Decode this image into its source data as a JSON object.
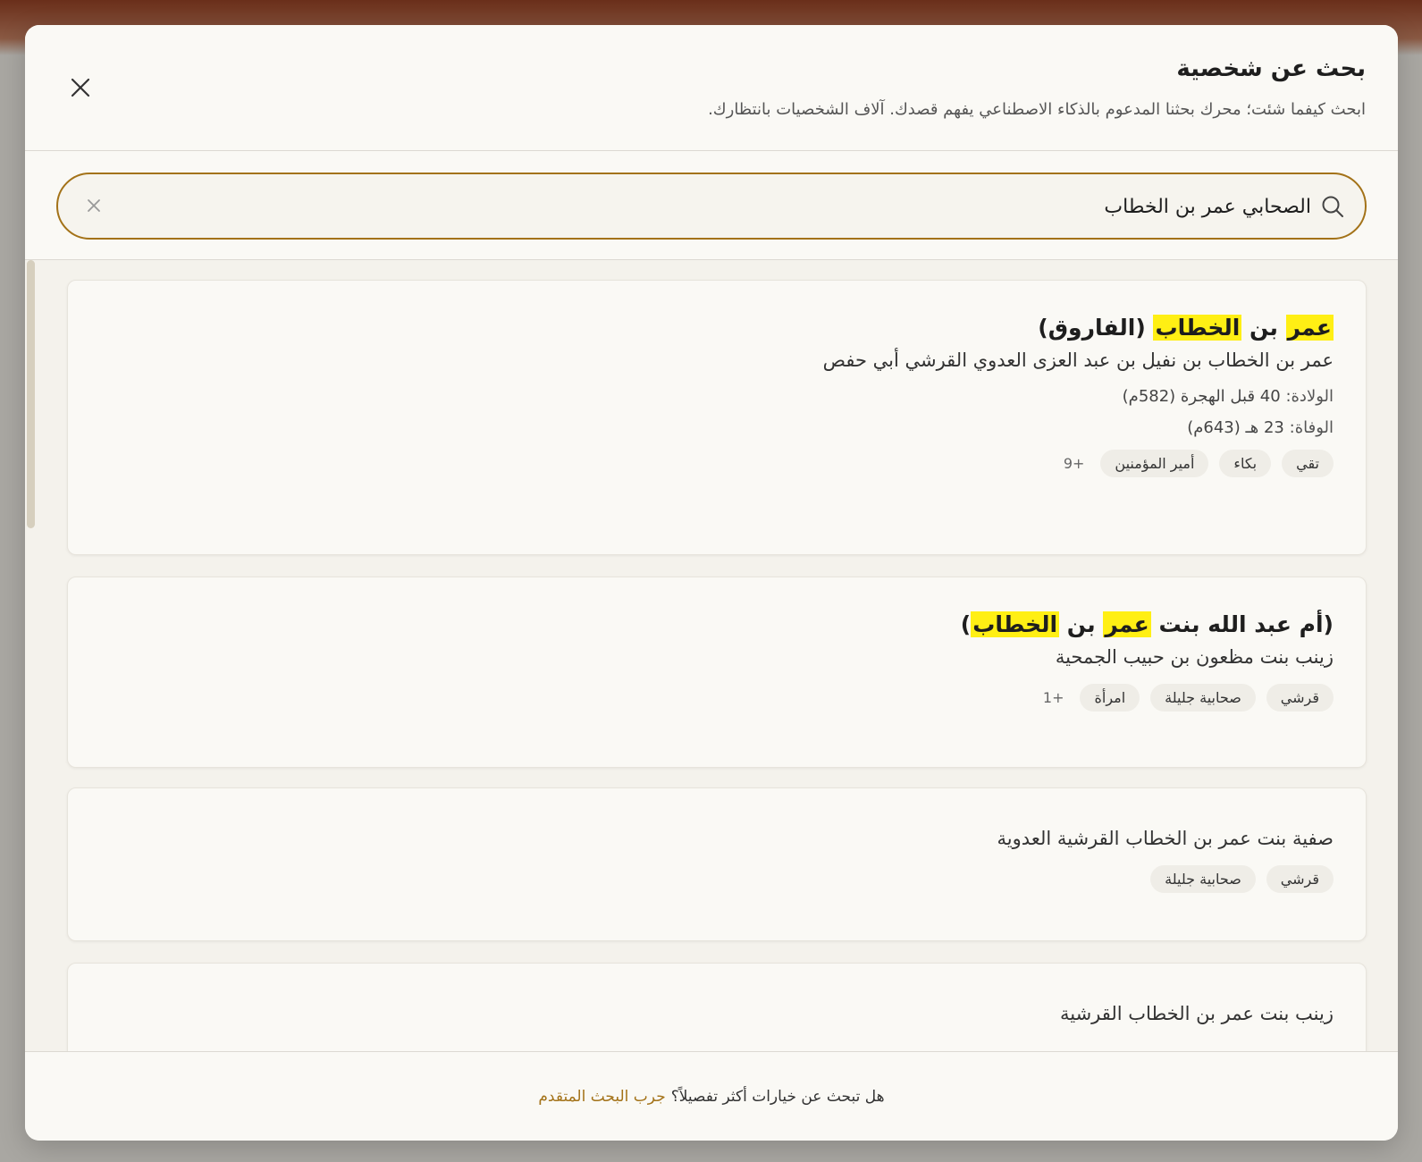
{
  "modal": {
    "title": "بحث عن شخصية",
    "subtitle": "ابحث كيفما شئت؛ محرك بحثنا المدعوم بالذكاء الاصطناعي يفهم قصدك. آلاف الشخصيات بانتظارك."
  },
  "search": {
    "value": "الصحابي عمر بن الخطاب"
  },
  "results": [
    {
      "title_parts": [
        {
          "text": "عمر",
          "hl": true
        },
        {
          "text": " بن ",
          "hl": false
        },
        {
          "text": "الخطاب",
          "hl": true
        },
        {
          "text": " (الفاروق)",
          "hl": false
        }
      ],
      "full_name": "عمر بن الخطاب بن نفيل بن عبد العزى العدوي القرشي أبي حفص",
      "birth_label": "الولادة:",
      "birth_value": "40 قبل الهجرة (582م)",
      "death_label": "الوفاة:",
      "death_value": "23 هـ (643م)",
      "tags": [
        "تقي",
        "بكاء",
        "أمير المؤمنين"
      ],
      "more": "+9"
    },
    {
      "title_parts": [
        {
          "text": "(أم عبد الله بنت ",
          "hl": false
        },
        {
          "text": "عمر",
          "hl": true
        },
        {
          "text": " بن ",
          "hl": false
        },
        {
          "text": "الخطاب",
          "hl": true
        },
        {
          "text": ")",
          "hl": false
        }
      ],
      "full_name": "زينب بنت مظعون بن حبيب الجمحية",
      "tags": [
        "قرشي",
        "صحابية جليلة",
        "امرأة"
      ],
      "more": "+1"
    },
    {
      "full_name": "صفية بنت عمر بن الخطاب القرشية العدوية",
      "tags": [
        "قرشي",
        "صحابية جليلة"
      ]
    },
    {
      "full_name": "زينب بنت عمر بن الخطاب القرشية"
    }
  ],
  "footer": {
    "question": "هل تبحث عن خيارات أكثر تفصيلاً؟",
    "link": "جرب البحث المتقدم"
  }
}
